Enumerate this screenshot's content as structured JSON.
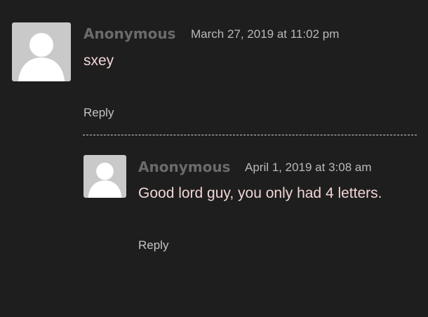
{
  "comments": [
    {
      "author": "Anonymous",
      "date": "March 27, 2019 at 11:02 pm",
      "text": "sxey",
      "reply_label": "Reply",
      "avatar_icon": "default-user-avatar-icon"
    },
    {
      "author": "Anonymous",
      "date": "April 1, 2019 at 3:08 am",
      "text": "Good lord guy, you only had 4 letters.",
      "reply_label": "Reply",
      "avatar_icon": "default-user-avatar-icon"
    }
  ],
  "colors": {
    "background": "#1e1e1e",
    "author": "#6b6b6b",
    "comment_text": "#f2d6d6",
    "avatar_bg": "#c9c9c9"
  }
}
